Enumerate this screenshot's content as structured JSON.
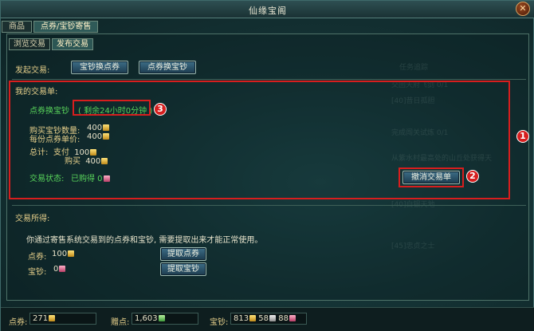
{
  "window": {
    "title": "仙缘宝阁",
    "close_icon": "close-icon"
  },
  "top_tabs": [
    {
      "label": "商品",
      "active": false
    },
    {
      "label": "点券/宝钞寄售",
      "active": true
    }
  ],
  "sub_tabs": [
    {
      "label": "浏览交易",
      "active": false
    },
    {
      "label": "发布交易",
      "active": true
    }
  ],
  "initiate": {
    "label": "发起交易:",
    "btn_baochao_to_dianquan": "宝钞换点券",
    "btn_dianquan_to_baochao": "点券换宝钞"
  },
  "my_order": {
    "heading": "我的交易单:",
    "type_label": "点券换宝钞",
    "time_left": "( 剩余24小时0分钟 )",
    "buy_qty_label": "购买宝钞数量:",
    "buy_qty_value": "400",
    "unit_price_label": "每份点券单价:",
    "unit_price_value": "400",
    "total_label": "总计:",
    "pay_label": "支付",
    "pay_value": "100",
    "buy_label": "购买",
    "buy_value": "400",
    "status_label": "交易状态:",
    "status_value": "已购得 0",
    "cancel_btn": "撤消交易单"
  },
  "proceeds": {
    "heading": "交易所得:",
    "note": "你通过寄售系统交易到的点券和宝钞, 需要提取出来才能正常使用。",
    "dianquan_label": "点券:",
    "dianquan_value": "100",
    "baochao_label": "宝钞:",
    "baochao_value": "0",
    "btn_withdraw_dianquan": "提取点券",
    "btn_withdraw_baochao": "提取宝钞"
  },
  "annotations": {
    "box1": "1",
    "box2": "2",
    "box3": "3"
  },
  "bottom": {
    "dianquan_label": "点券:",
    "dianquan_value": "271",
    "zengdian_label": "赠点:",
    "zengdian_value": "1,603",
    "baochao_label": "宝钞:",
    "baochao_value_a": "813",
    "baochao_value_b": "58",
    "baochao_value_c": "88"
  },
  "colors": {
    "accent_red": "#d71e1e",
    "text_green": "#58d35a",
    "text_gold": "#e6cf8a"
  }
}
